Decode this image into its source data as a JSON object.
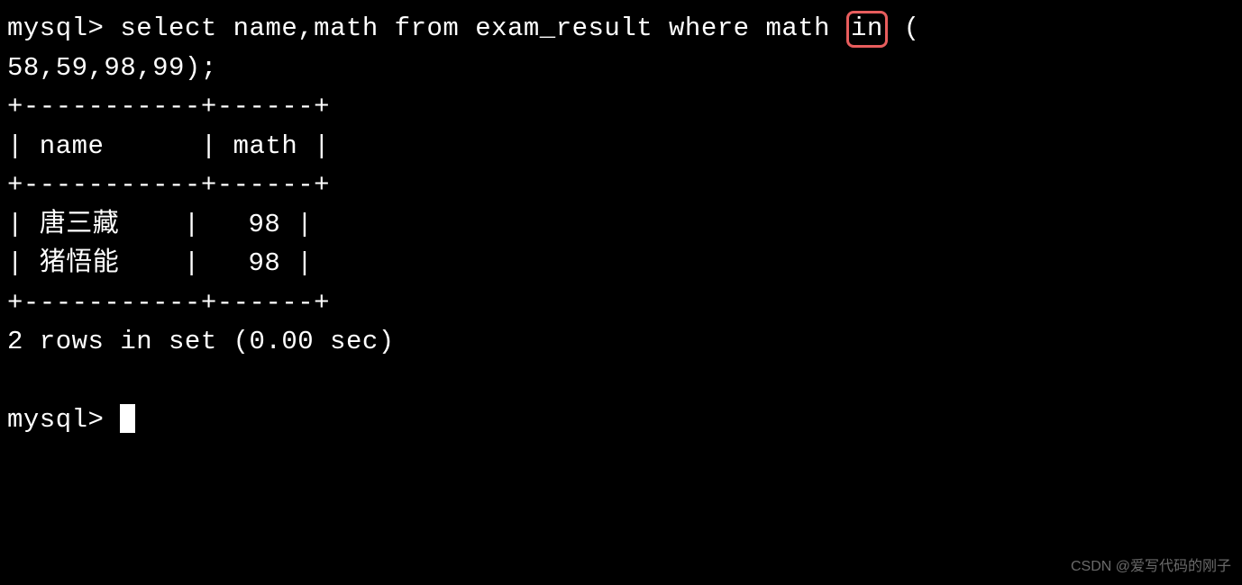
{
  "prompt": "mysql>",
  "query": {
    "part1": "select name,math from exam_result where math ",
    "highlighted": "in",
    "part2": " (",
    "line2": "58,59,98,99);"
  },
  "table": {
    "border": "+-----------+------+",
    "header": "| name      | math |",
    "rows": [
      "| 唐三藏    |   98 |",
      "| 猪悟能    |   98 |"
    ]
  },
  "result_status": "2 rows in set (0.00 sec)",
  "watermark": "CSDN @爱写代码的刚子"
}
